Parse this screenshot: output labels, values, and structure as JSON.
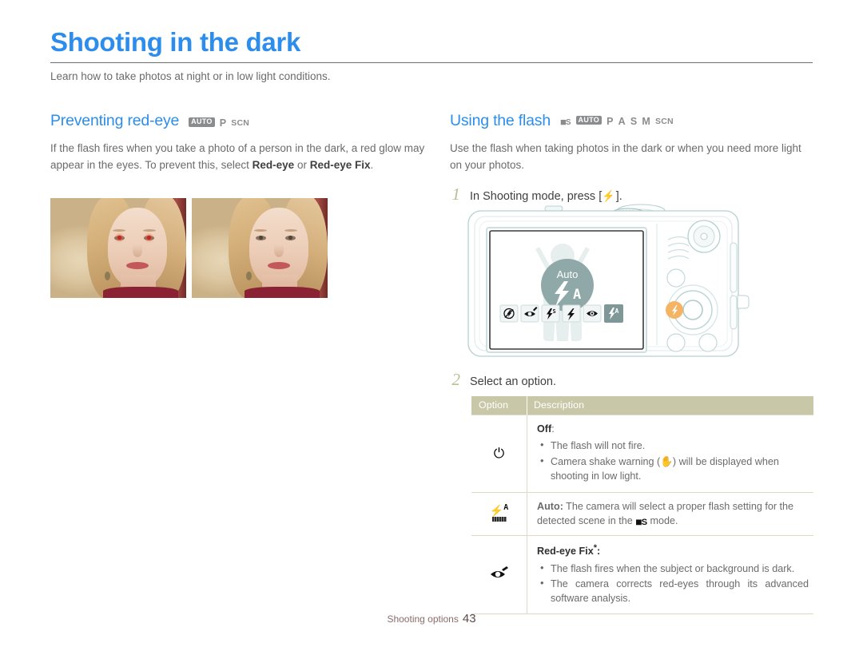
{
  "document": {
    "title": "Shooting in the dark",
    "subtitle": "Learn how to take photos at night or in low light conditions.",
    "footer_label": "Shooting options",
    "footer_page": "43",
    "accent_color": "#2c8ded",
    "table_header_color": "#c8c8a9",
    "step_number_color": "#b5c295"
  },
  "left_section": {
    "heading": "Preventing red-eye",
    "modes": [
      {
        "type": "badge",
        "label": "AUTO",
        "name": "mode-auto-icon"
      },
      {
        "type": "text",
        "label": "P",
        "name": "mode-p-icon"
      },
      {
        "type": "text-small",
        "label": "SCN",
        "name": "mode-scn-icon"
      }
    ],
    "paragraph_1": "If the flash fires when you take a photo of a person in the dark, a red glow may appear in the eyes. To prevent this, select ",
    "paragraph_bold_1": "Red-eye",
    "paragraph_2": " or ",
    "paragraph_bold_2": "Red-eye Fix",
    "paragraph_3": ".",
    "photos": [
      {
        "caption": "",
        "name": "photo-with-red-eye",
        "state": "red-eye"
      },
      {
        "caption": "",
        "name": "photo-red-eye-corrected",
        "state": "corrected"
      }
    ]
  },
  "right_section": {
    "heading": "Using the flash",
    "modes": [
      {
        "type": "smart",
        "label": "Smart Auto",
        "name": "mode-smart-auto-icon"
      },
      {
        "type": "badge",
        "label": "AUTO",
        "name": "mode-auto-icon"
      },
      {
        "type": "text",
        "label": "P",
        "name": "mode-p-icon"
      },
      {
        "type": "text",
        "label": "A",
        "name": "mode-a-icon"
      },
      {
        "type": "text",
        "label": "S",
        "name": "mode-s-icon"
      },
      {
        "type": "text",
        "label": "M",
        "name": "mode-m-icon"
      },
      {
        "type": "text-small",
        "label": "SCN",
        "name": "mode-scn-icon"
      }
    ],
    "intro": "Use the flash when taking photos in the dark or when you need more light on your photos.",
    "steps": [
      {
        "number": "1",
        "text_before": "In Shooting mode, press [",
        "text_after": "]."
      },
      {
        "number": "2",
        "text_before": "Select an option.",
        "text_after": ""
      }
    ]
  },
  "camera": {
    "lcd_badge_label": "Auto",
    "flash_options_on_lcd": [
      {
        "name": "lcd-flash-off-icon",
        "label": "Off",
        "selected": false
      },
      {
        "name": "lcd-red-eye-fix-icon",
        "label": "Red-eye Fix",
        "selected": false
      },
      {
        "name": "lcd-slow-sync-icon",
        "label": "Slow Sync",
        "selected": false
      },
      {
        "name": "lcd-fill-in-icon",
        "label": "Fill in",
        "selected": false
      },
      {
        "name": "lcd-red-eye-icon",
        "label": "Red-eye",
        "selected": false
      },
      {
        "name": "lcd-auto-flash-icon",
        "label": "Auto",
        "selected": true
      }
    ],
    "highlighted_button": "flash-button"
  },
  "table": {
    "columns": [
      "Option",
      "Description"
    ],
    "rows": [
      {
        "icon_name": "flash-off-icon",
        "title": "Off",
        "title_suffix": ":",
        "bullets": [
          "The flash will not fire.",
          "Camera shake warning ( ) will be displayed when shooting in low light."
        ],
        "bullet_1": "The flash will not fire.",
        "bullet_2_before": "Camera shake warning (",
        "bullet_2_after": ") will be displayed when shooting in low light."
      },
      {
        "icon_name": "auto-flash-icon",
        "title": "Auto",
        "title_suffix": ":",
        "text_before": " The camera will select a proper flash setting for the detected scene in the ",
        "text_after": " mode."
      },
      {
        "icon_name": "red-eye-fix-icon",
        "title": "Red-eye Fix",
        "title_sup": "*",
        "title_suffix": ":",
        "bullet_1": "The flash fires when the subject or background is dark.",
        "bullet_2": "The camera corrects red-eyes through its advanced software analysis."
      }
    ]
  }
}
